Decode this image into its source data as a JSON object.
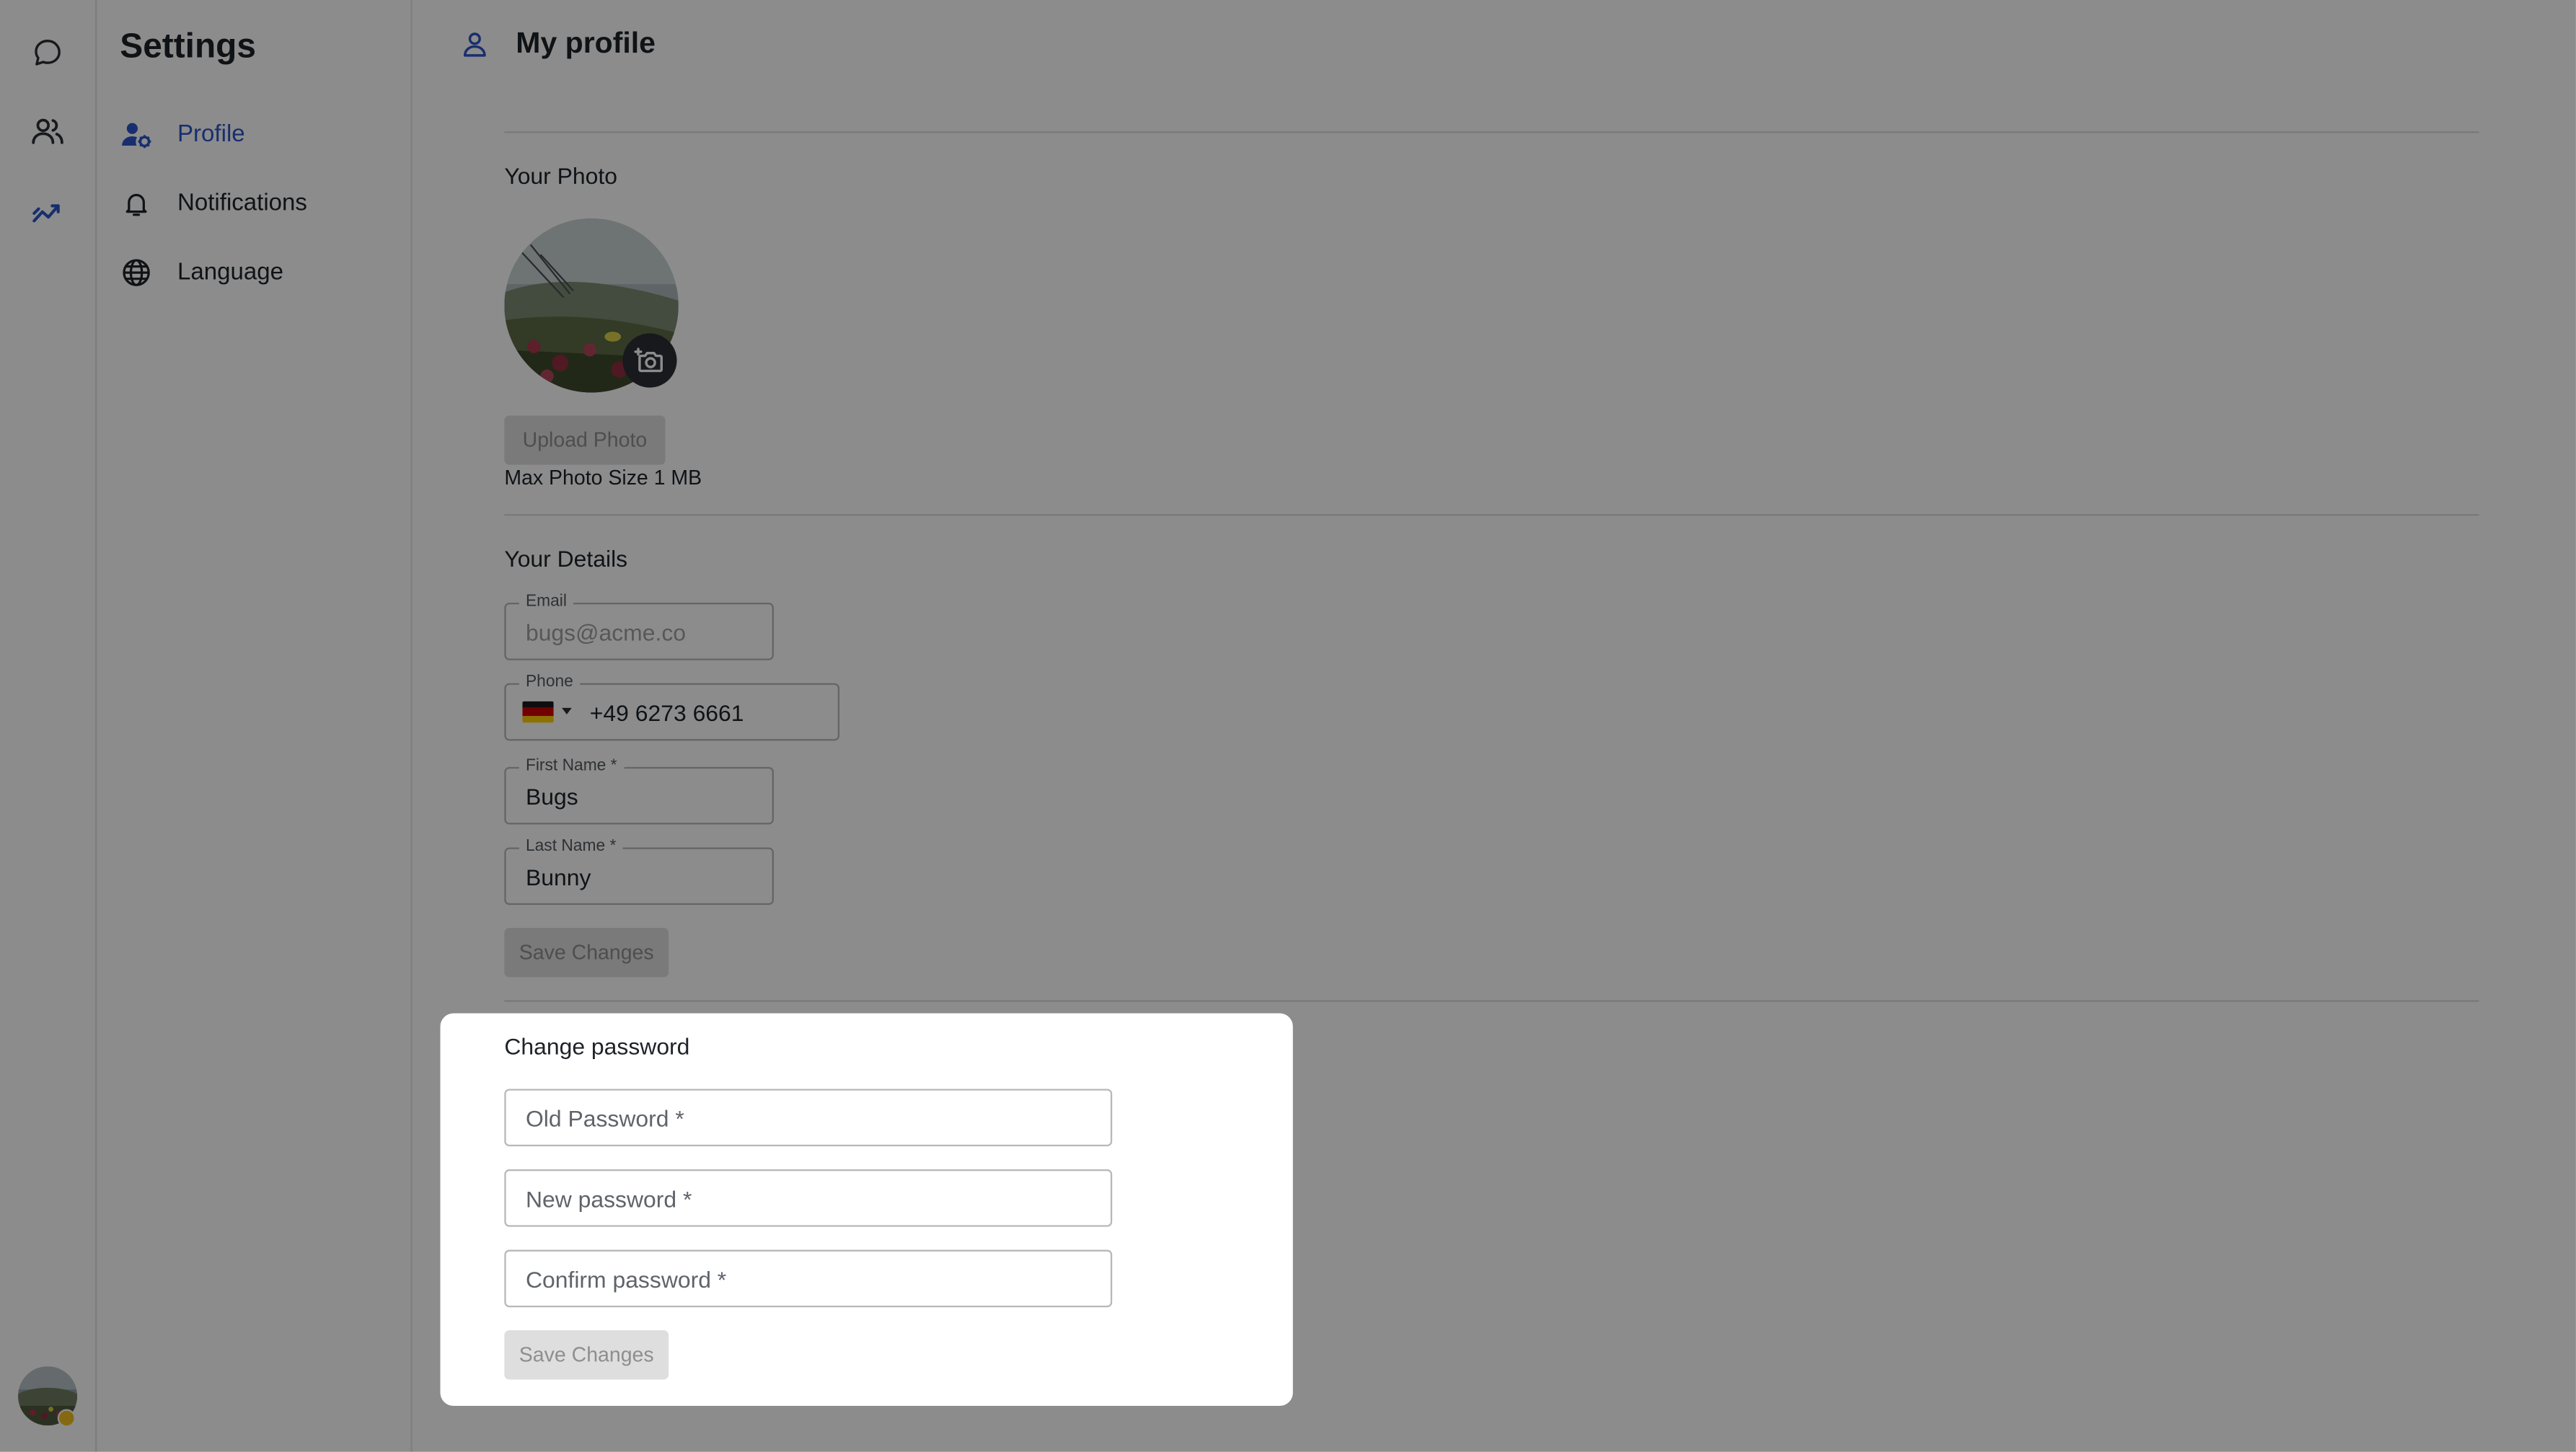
{
  "sidebar": {
    "title": "Settings",
    "items": [
      {
        "label": "Profile",
        "icon": "user-gear-icon",
        "active": true
      },
      {
        "label": "Notifications",
        "icon": "bell-icon",
        "active": false
      },
      {
        "label": "Language",
        "icon": "globe-icon",
        "active": false
      }
    ]
  },
  "rail": {
    "icons": [
      "chat-bubble-icon",
      "users-icon",
      "analytics-icon"
    ],
    "active_color": "#2d55c9"
  },
  "header": {
    "title": "My profile",
    "icon": "person-icon"
  },
  "photo_section": {
    "title": "Your Photo",
    "upload_label": "Upload Photo",
    "hint": "Max Photo Size 1 MB"
  },
  "details": {
    "title": "Your Details",
    "email": {
      "label": "Email",
      "value": "bugs@acme.co"
    },
    "phone": {
      "label": "Phone",
      "value": "+49 6273 6661",
      "country": "Germany"
    },
    "first_name": {
      "label": "First Name *",
      "value": "Bugs"
    },
    "last_name": {
      "label": "Last Name *",
      "value": "Bunny"
    },
    "save_label": "Save Changes"
  },
  "password_modal": {
    "title": "Change password",
    "old_placeholder": "Old Password *",
    "new_placeholder": "New password *",
    "confirm_placeholder": "Confirm password *",
    "save_label": "Save Changes"
  },
  "colors": {
    "accent": "#2d55c9",
    "status_dot": "#f0c020"
  }
}
